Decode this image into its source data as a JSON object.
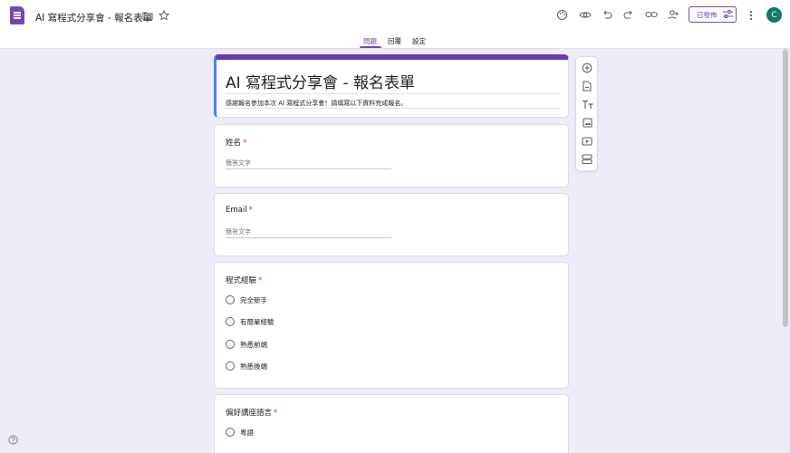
{
  "header": {
    "doc_title": "AI 寫程式分享會 - 報名表單",
    "publish_label": "已發佈",
    "avatar_initial": "C"
  },
  "tabs": [
    {
      "label": "問題",
      "active": true
    },
    {
      "label": "回覆",
      "active": false
    },
    {
      "label": "設定",
      "active": false
    }
  ],
  "form": {
    "title": "AI 寫程式分享會 - 報名表單",
    "description": "感謝報名參加本次 AI 寫程式分享會！請填寫以下資料完成報名。"
  },
  "questions": [
    {
      "label": "姓名",
      "required_mark": "*",
      "placeholder": "簡答文字"
    },
    {
      "label": "Email",
      "required_mark": "*",
      "placeholder": "簡答文字"
    },
    {
      "label": "程式經驗",
      "required_mark": "*",
      "options": [
        "完全新手",
        "有簡單經驗",
        "熟悉前端",
        "熟悉後端"
      ]
    },
    {
      "label": "偏好講座語言",
      "required_mark": "*",
      "options": [
        "粵語"
      ]
    }
  ],
  "icons": {
    "topbar": [
      "folder-icon",
      "star-icon",
      "palette-icon",
      "preview-eye-icon",
      "undo-icon",
      "redo-icon",
      "link-icon",
      "add-collaborator-icon",
      "settings-sliders-icon",
      "more-vert-icon"
    ],
    "side_toolbar": [
      "add-question-icon",
      "import-questions-icon",
      "add-title-icon",
      "add-image-icon",
      "add-video-icon",
      "add-section-icon"
    ],
    "footer": [
      "help-icon"
    ]
  },
  "colors": {
    "accent": "#7248b9",
    "header_stripe": "#673ab7",
    "background": "#f0ebf8",
    "required": "#d93025",
    "avatar": "#0b7a6b"
  }
}
